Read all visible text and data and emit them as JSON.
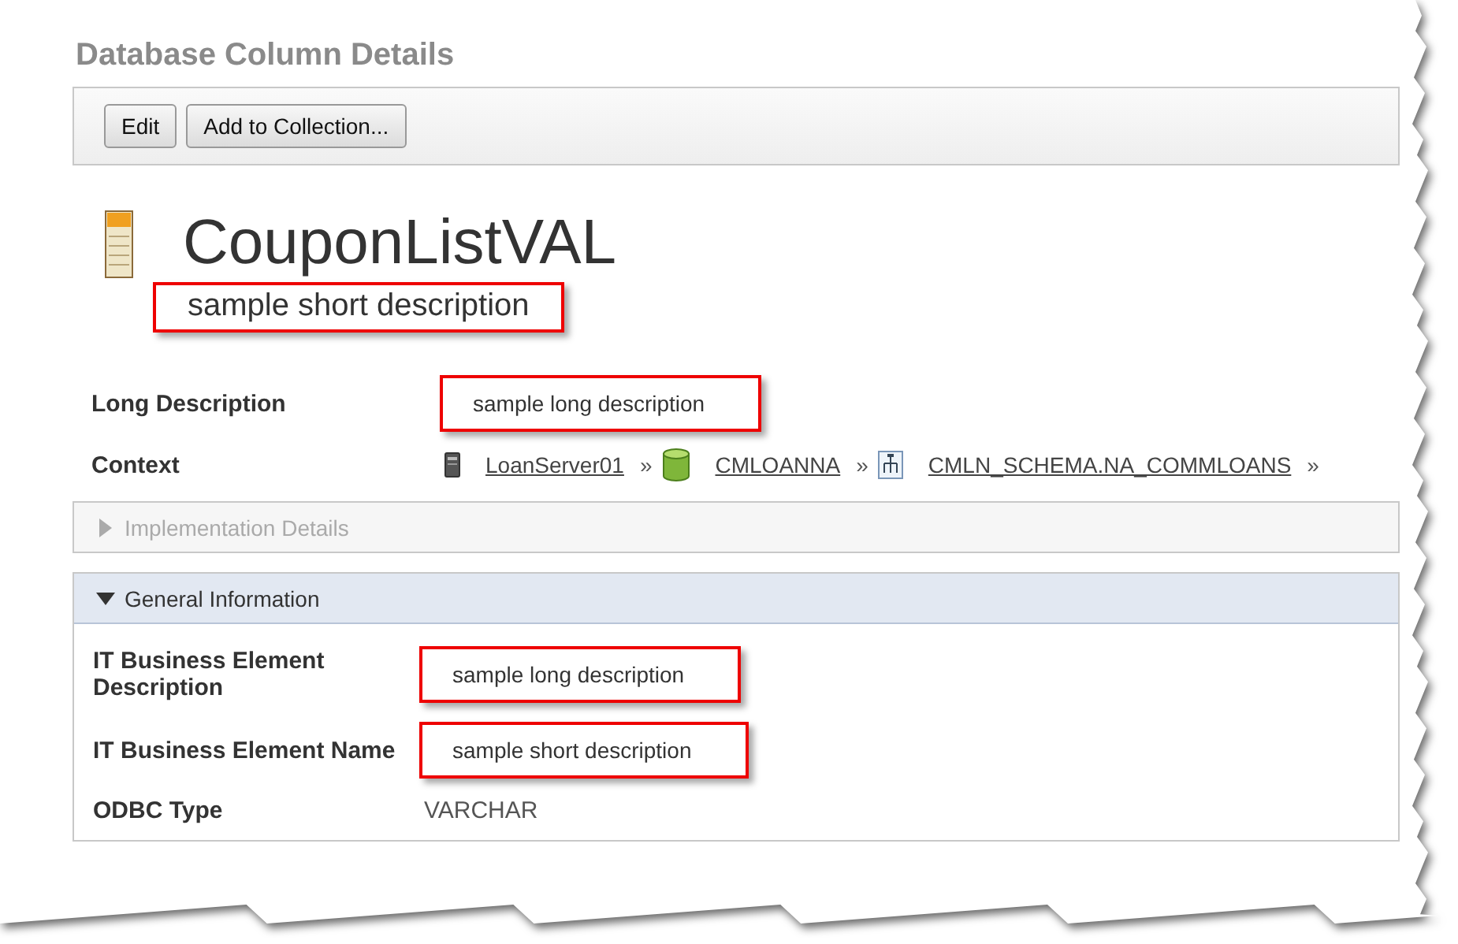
{
  "page_title": "Database Column Details",
  "toolbar": {
    "buttons": [
      "Edit",
      "Add to Collection..."
    ]
  },
  "heading": {
    "title": "CouponListVAL",
    "short_description": "sample short description",
    "highlighted": true
  },
  "fields": [
    {
      "label": "Long Description",
      "value": "sample long description",
      "highlighted": true
    }
  ],
  "context": {
    "label": "Context",
    "separator": "»",
    "items": [
      {
        "text": "LoanServer01",
        "kind": "server"
      },
      {
        "text": "CMLOANNA",
        "kind": "database"
      },
      {
        "text": "CMLN_SCHEMA.NA_COMMLOANS",
        "kind": "schema"
      }
    ]
  },
  "sections": [
    {
      "title": "Implementation Details",
      "expanded": false,
      "disabled": true
    },
    {
      "title": "General Information",
      "expanded": true,
      "disabled": false,
      "fields": [
        {
          "label": "IT Business Element Description",
          "value": "sample long description",
          "highlighted": true
        },
        {
          "label": "IT Business Element Name",
          "value": "sample short description",
          "highlighted": true
        },
        {
          "label": "ODBC Type",
          "value": "VARCHAR",
          "highlighted": false
        }
      ]
    }
  ]
}
